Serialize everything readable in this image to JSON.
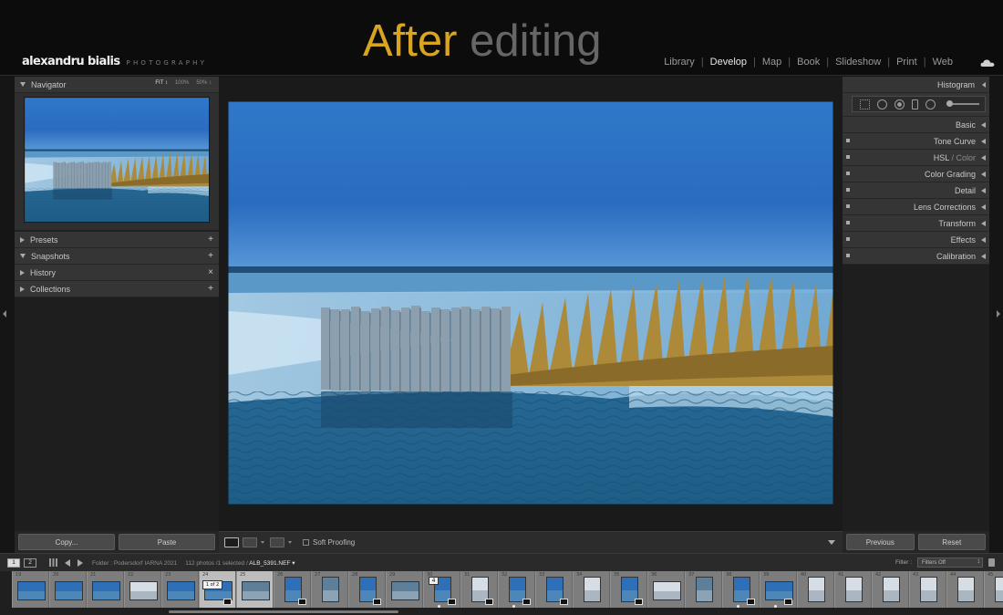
{
  "brand": {
    "name": "alexandru bialis",
    "tagline": "PHOTOGRAPHY"
  },
  "headline": {
    "word1": "After",
    "word2": "editing"
  },
  "modules": [
    "Library",
    "Develop",
    "Map",
    "Book",
    "Slideshow",
    "Print",
    "Web"
  ],
  "active_module": "Develop",
  "left_panel": {
    "navigator": {
      "title": "Navigator",
      "zoom_fit": "FIT ↕",
      "zoom_100": "100%",
      "zoom_50": "50% ↕"
    },
    "presets": {
      "title": "Presets",
      "action": "+"
    },
    "snapshots": {
      "title": "Snapshots",
      "action": "+"
    },
    "history": {
      "title": "History",
      "action": "×"
    },
    "collections": {
      "title": "Collections",
      "action": "+"
    },
    "copy_button": "Copy...",
    "paste_button": "Paste"
  },
  "toolbar": {
    "soft_proofing": "Soft Proofing"
  },
  "right_panel": {
    "histogram": "Histogram",
    "basic": "Basic",
    "tone_curve": "Tone Curve",
    "hsl": "HSL",
    "hsl_sep": " / ",
    "hsl_color": "Color",
    "color_grading": "Color Grading",
    "detail": "Detail",
    "lens_corrections": "Lens Corrections",
    "transform": "Transform",
    "effects": "Effects",
    "calibration": "Calibration",
    "previous_button": "Previous",
    "reset_button": "Reset"
  },
  "filmstrip_header": {
    "monitor1": "1",
    "monitor2": "2",
    "folder": "Folder : Podersdorf IARNA 2021",
    "counts": "112 photos /1 selected /",
    "filename": "ALB_5391.NEF",
    "filter_label": "Filter :",
    "filter_value": "Filters Off"
  },
  "filmstrip": {
    "cells": [
      {
        "num": "19",
        "orient": "land",
        "tone": "blue"
      },
      {
        "num": "20",
        "orient": "land",
        "tone": "blue"
      },
      {
        "num": "21",
        "orient": "land",
        "tone": "blue"
      },
      {
        "num": "22",
        "orient": "land",
        "tone": "white"
      },
      {
        "num": "23",
        "orient": "land",
        "tone": "blue"
      },
      {
        "num": "24",
        "orient": "land",
        "tone": "blue",
        "stack": "1 of 2",
        "selected": true,
        "edited": true
      },
      {
        "num": "25",
        "orient": "land",
        "tone": "gray",
        "selected": true
      },
      {
        "num": "26",
        "orient": "portrait",
        "tone": "blue",
        "edited": true
      },
      {
        "num": "27",
        "orient": "portrait",
        "tone": "gray"
      },
      {
        "num": "28",
        "orient": "portrait",
        "tone": "blue",
        "edited": true
      },
      {
        "num": "29",
        "orient": "land",
        "tone": "gray"
      },
      {
        "num": "30",
        "orient": "portrait",
        "tone": "blue",
        "count": "4",
        "edited": true,
        "dot": true
      },
      {
        "num": "31",
        "orient": "portrait",
        "tone": "white",
        "edited": true
      },
      {
        "num": "32",
        "orient": "portrait",
        "tone": "blue",
        "edited": true,
        "dot": true
      },
      {
        "num": "33",
        "orient": "portrait",
        "tone": "blue",
        "edited": true
      },
      {
        "num": "34",
        "orient": "portrait",
        "tone": "white"
      },
      {
        "num": "35",
        "orient": "portrait",
        "tone": "blue",
        "edited": true
      },
      {
        "num": "36",
        "orient": "land",
        "tone": "white"
      },
      {
        "num": "37",
        "orient": "portrait",
        "tone": "gray"
      },
      {
        "num": "38",
        "orient": "portrait",
        "tone": "blue",
        "edited": true,
        "dot": true
      },
      {
        "num": "39",
        "orient": "land",
        "tone": "blue",
        "edited": true,
        "dot": true
      },
      {
        "num": "40",
        "orient": "portrait",
        "tone": "white"
      },
      {
        "num": "41",
        "orient": "portrait",
        "tone": "white"
      },
      {
        "num": "42",
        "orient": "portrait",
        "tone": "white"
      },
      {
        "num": "43",
        "orient": "portrait",
        "tone": "white"
      },
      {
        "num": "44",
        "orient": "portrait",
        "tone": "white"
      },
      {
        "num": "45",
        "orient": "portrait",
        "tone": "white"
      }
    ]
  },
  "colors": {
    "accent_gold": "#d9a520",
    "title_gray": "#666666",
    "panel_bg": "#353535"
  }
}
